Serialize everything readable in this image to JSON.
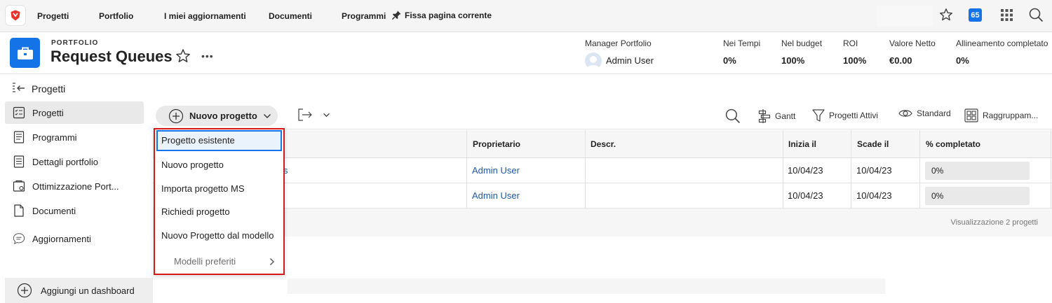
{
  "topnav": {
    "items": [
      "Progetti",
      "Portfolio",
      "I miei aggiornamenti",
      "Documenti",
      "Programmi"
    ],
    "pin_label": "Fissa pagina corrente",
    "notification_count": "65"
  },
  "header": {
    "eyebrow": "PORTFOLIO",
    "title": "Request Queues",
    "more": "•••",
    "manager_label": "Manager Portfolio",
    "manager_name": "Admin User",
    "kpis": [
      {
        "label": "Nei Tempi",
        "value": "0%"
      },
      {
        "label": "Nel budget",
        "value": "100%"
      },
      {
        "label": "ROI",
        "value": "100%"
      },
      {
        "label": "Valore Netto",
        "value": "€0.00"
      },
      {
        "label": "Allineamento completato",
        "value": "0%"
      }
    ]
  },
  "section_title": "Progetti",
  "sidebar": {
    "items": [
      {
        "label": "Progetti",
        "icon": "project-list-icon",
        "active": true
      },
      {
        "label": "Programmi",
        "icon": "document-icon",
        "active": false
      },
      {
        "label": "Dettagli portfolio",
        "icon": "details-icon",
        "active": false
      },
      {
        "label": "Ottimizzazione Port...",
        "icon": "optimizer-icon",
        "active": false
      },
      {
        "label": "Documenti",
        "icon": "file-icon",
        "active": false
      },
      {
        "label": "Aggiornamenti",
        "icon": "chat-bubble-icon",
        "active": false
      }
    ],
    "add_dashboard": "Aggiungi un dashboard"
  },
  "toolbar": {
    "new_project": "Nuovo progetto",
    "gantt": "Gantt",
    "filter": "Progetti Attivi",
    "view": "Standard",
    "grouping": "Raggruppam..."
  },
  "table": {
    "columns": [
      "Proprietario",
      "Descr.",
      "Inizia il",
      "Scade il",
      "% completato"
    ],
    "rows": [
      {
        "name_fragment": "s",
        "owner": "Admin User",
        "description": "",
        "start": "10/04/23",
        "due": "10/04/23",
        "percent": "0%",
        "percent_value": 0
      },
      {
        "name_fragment": "",
        "owner": "Admin User",
        "description": "",
        "start": "10/04/23",
        "due": "10/04/23",
        "percent": "0%",
        "percent_value": 0
      }
    ],
    "footer": "Visualizzazione 2 progetti"
  },
  "dropdown": {
    "items": [
      "Progetto esistente",
      "Nuovo progetto",
      "Importa progetto MS",
      "Richiedi progetto",
      "Nuovo Progetto dal modello"
    ],
    "selected_index": 0,
    "submenu": "Modelli preferiti"
  },
  "colors": {
    "accent": "#1473e6",
    "highlight_border": "#d7191c",
    "link": "#1e5aa8",
    "logo": "#e8322b"
  }
}
